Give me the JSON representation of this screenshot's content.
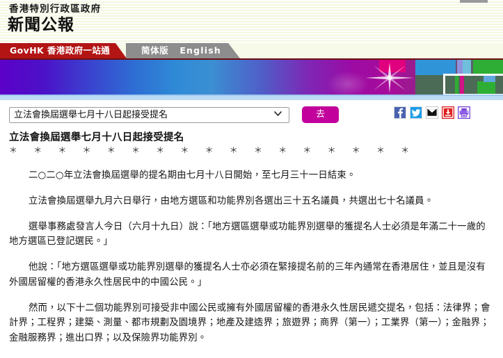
{
  "masthead": {
    "gov_title": "香港特別行政區政府",
    "site_title": "新聞公報"
  },
  "nav": {
    "govhk_tab": "GovHK 香港政府一站通",
    "simplified_link": "简体版",
    "english_link": "English"
  },
  "controls": {
    "selected_topic": "立法會換屆選舉七月十八日起接受提名",
    "go_label": "去",
    "options": [
      "立法會換屆選舉七月十八日起接受提名"
    ]
  },
  "social": {
    "facebook": "facebook-share",
    "twitter": "twitter-share",
    "email": "email-share",
    "download": "download",
    "print": "print"
  },
  "article": {
    "headline": "立法會換屆選舉七月十八日起接受提名",
    "separator": "＊　＊　＊　＊　＊　＊　＊　＊　＊　＊　＊　＊　＊　＊　＊　＊　＊",
    "paragraphs": [
      "二○二○年立法會換屆選舉的提名期由七月十八日開始，至七月三十一日結束。",
      "立法會換屆選舉九月六日舉行，由地方選區和功能界別各選出三十五名議員，共選出七十名議員。",
      "選舉事務處發言人今日（六月十九日）說：「地方選區選舉或功能界別選舉的獲提名人士必須是年滿二十一歲的地方選區已登記選民。」",
      "他說：「地方選區選舉或功能界別選舉的獲提名人士亦必須在緊接提名前的三年內通常在香港居住，並且是沒有外國居留權的香港永久性居民中的中國公民。」",
      "然而，以下十二個功能界別可接受非中國公民或擁有外國居留權的香港永久性居民遞交提名，包括：法律界；會計界；工程界；建築、測量、都市規劃及園境界；地產及建造界；旅遊界；商界（第一）；工業界（第一）；金融界；金融服務界；進出口界；以及保險界功能界別。"
    ]
  },
  "colors": {
    "govhk_tab_red": "#b31515",
    "lang_tab_grey": "#8d8d8d",
    "go_button_magenta": "#c2009b",
    "masthead_cream": "#f7f9e9",
    "underbanner_blue": "#bcdcf5",
    "facebook_blue": "#4a63b0",
    "twitter_blue": "#1e9de8",
    "email_black": "#111111",
    "download_red": "#e02020",
    "print_purple": "#7a44d8"
  }
}
